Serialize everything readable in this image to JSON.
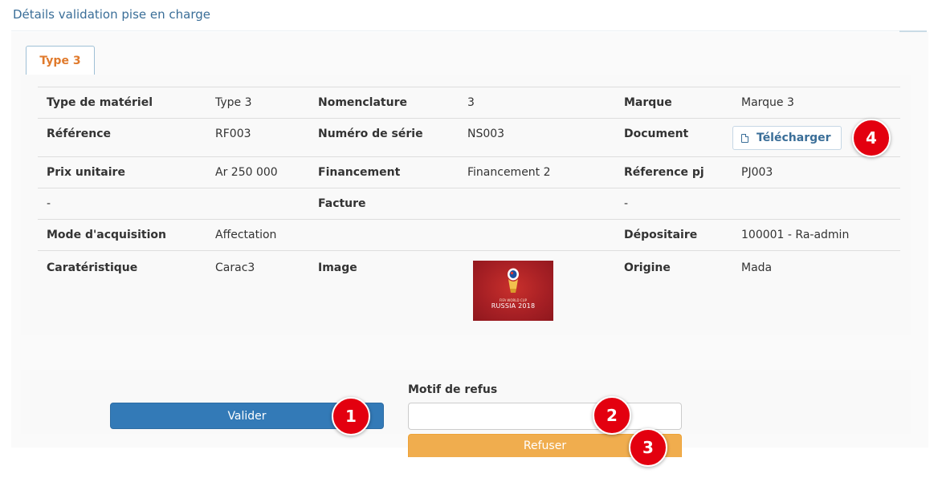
{
  "page": {
    "title": "Détails validation pise en charge"
  },
  "tabs": [
    {
      "label": "Type 3",
      "active": true
    }
  ],
  "details": {
    "row1": {
      "type_materiel_label": "Type de matériel",
      "type_materiel_value": "Type 3",
      "nomenclature_label": "Nomenclature",
      "nomenclature_value": "3",
      "marque_label": "Marque",
      "marque_value": "Marque 3"
    },
    "row2": {
      "reference_label": "Référence",
      "reference_value": "RF003",
      "numero_serie_label": "Numéro de série",
      "numero_serie_value": "NS003",
      "document_label": "Document",
      "download_label": "Télécharger",
      "download_icon": "file-icon"
    },
    "row3": {
      "prix_label": "Prix unitaire",
      "prix_value": "Ar 250 000",
      "financement_label": "Financement",
      "financement_value": "Financement 2",
      "reference_pj_label": "Réference pj",
      "reference_pj_value": "PJ003"
    },
    "row4": {
      "col1_value": "-",
      "facture_label": "Facture",
      "col5_value": "-"
    },
    "row5": {
      "mode_label": "Mode d'acquisition",
      "mode_value": "Affectation",
      "depositaire_label": "Dépositaire",
      "depositaire_value": "100001 - Ra-admin"
    },
    "row6": {
      "caracteristique_label": "Caratéristique",
      "caracteristique_value": "Carac3",
      "image_label": "Image",
      "image_caption": "RUSSIA 2018",
      "image_caption_small": "FIFA WORLD CUP",
      "origine_label": "Origine",
      "origine_value": "Mada"
    }
  },
  "actions": {
    "valider_label": "Valider",
    "motif_label": "Motif de refus",
    "motif_value": "",
    "refuser_label": "Refuser"
  },
  "markers": [
    "1",
    "2",
    "3",
    "4"
  ],
  "colors": {
    "title": "#3a6e98",
    "tab_active_text": "#e07a2c",
    "primary": "#337ab7",
    "warning": "#f0ad4e",
    "marker": "#e3000f"
  }
}
